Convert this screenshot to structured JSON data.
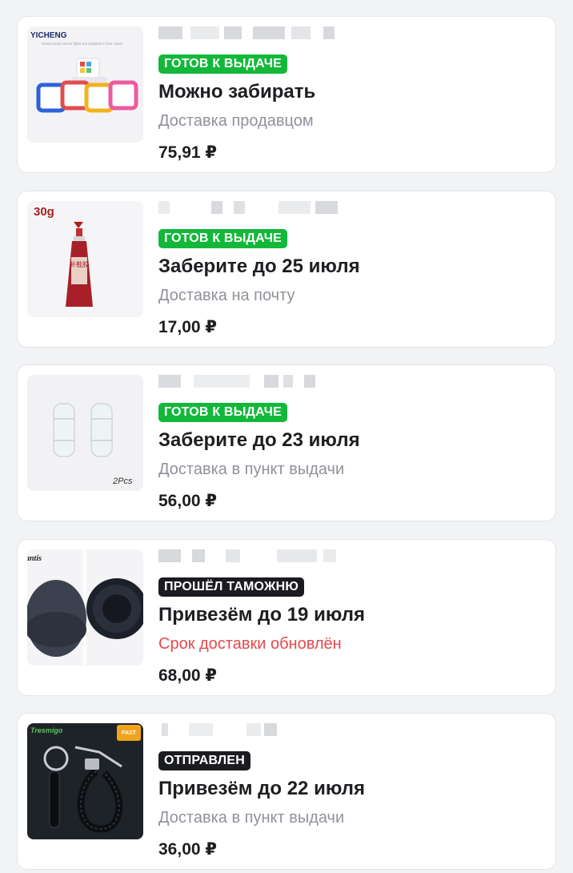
{
  "orders": [
    {
      "badge": "ГОТОВ К ВЫДАЧЕ",
      "badge_color": "#13b83a",
      "title": "Можно забирать",
      "subtitle": "Доставка продавцом",
      "price": "75,91 ₽",
      "image": "colorful square night lights product photo",
      "image_text": "YICHENG",
      "image_caption": "Human body sensor lights are available in four colors"
    },
    {
      "badge": "ГОТОВ К ВЫДАЧЕ",
      "badge_color": "#13b83a",
      "title": "Заберите до 25 июля",
      "subtitle": "Доставка на почту",
      "price": "17,00 ₽",
      "image": "red tube of shoe glue",
      "image_text": "30g",
      "image_caption": "补鞋胶"
    },
    {
      "badge": "ГОТОВ К ВЫДАЧЕ",
      "badge_color": "#13b83a",
      "title": "Заберите до 23 июля",
      "subtitle": "Доставка в пункт выдачи",
      "price": "56,00 ₽",
      "image": "two clear plastic spool parts",
      "image_text": "2Pcs"
    },
    {
      "badge": "ПРОШЁЛ ТАМОЖНЮ",
      "badge_color": "#1b1c1f",
      "title": "Привезём до 19 июля",
      "subtitle": "Срок доставки обновлён",
      "subtitle_color": "#e5484d",
      "price": "68,00 ₽",
      "image": "black knit hat and dark fur pompom",
      "image_text": "antis"
    },
    {
      "badge": "ОТПРАВЛЕН",
      "badge_color": "#1b1c1f",
      "title": "Привезём до 22 июля",
      "subtitle": "Доставка в пункт выдачи",
      "price": "36,00 ₽",
      "image": "black braided keychain with metal clasp",
      "image_text": "Tresmigo",
      "image_badge": "FAST"
    }
  ]
}
